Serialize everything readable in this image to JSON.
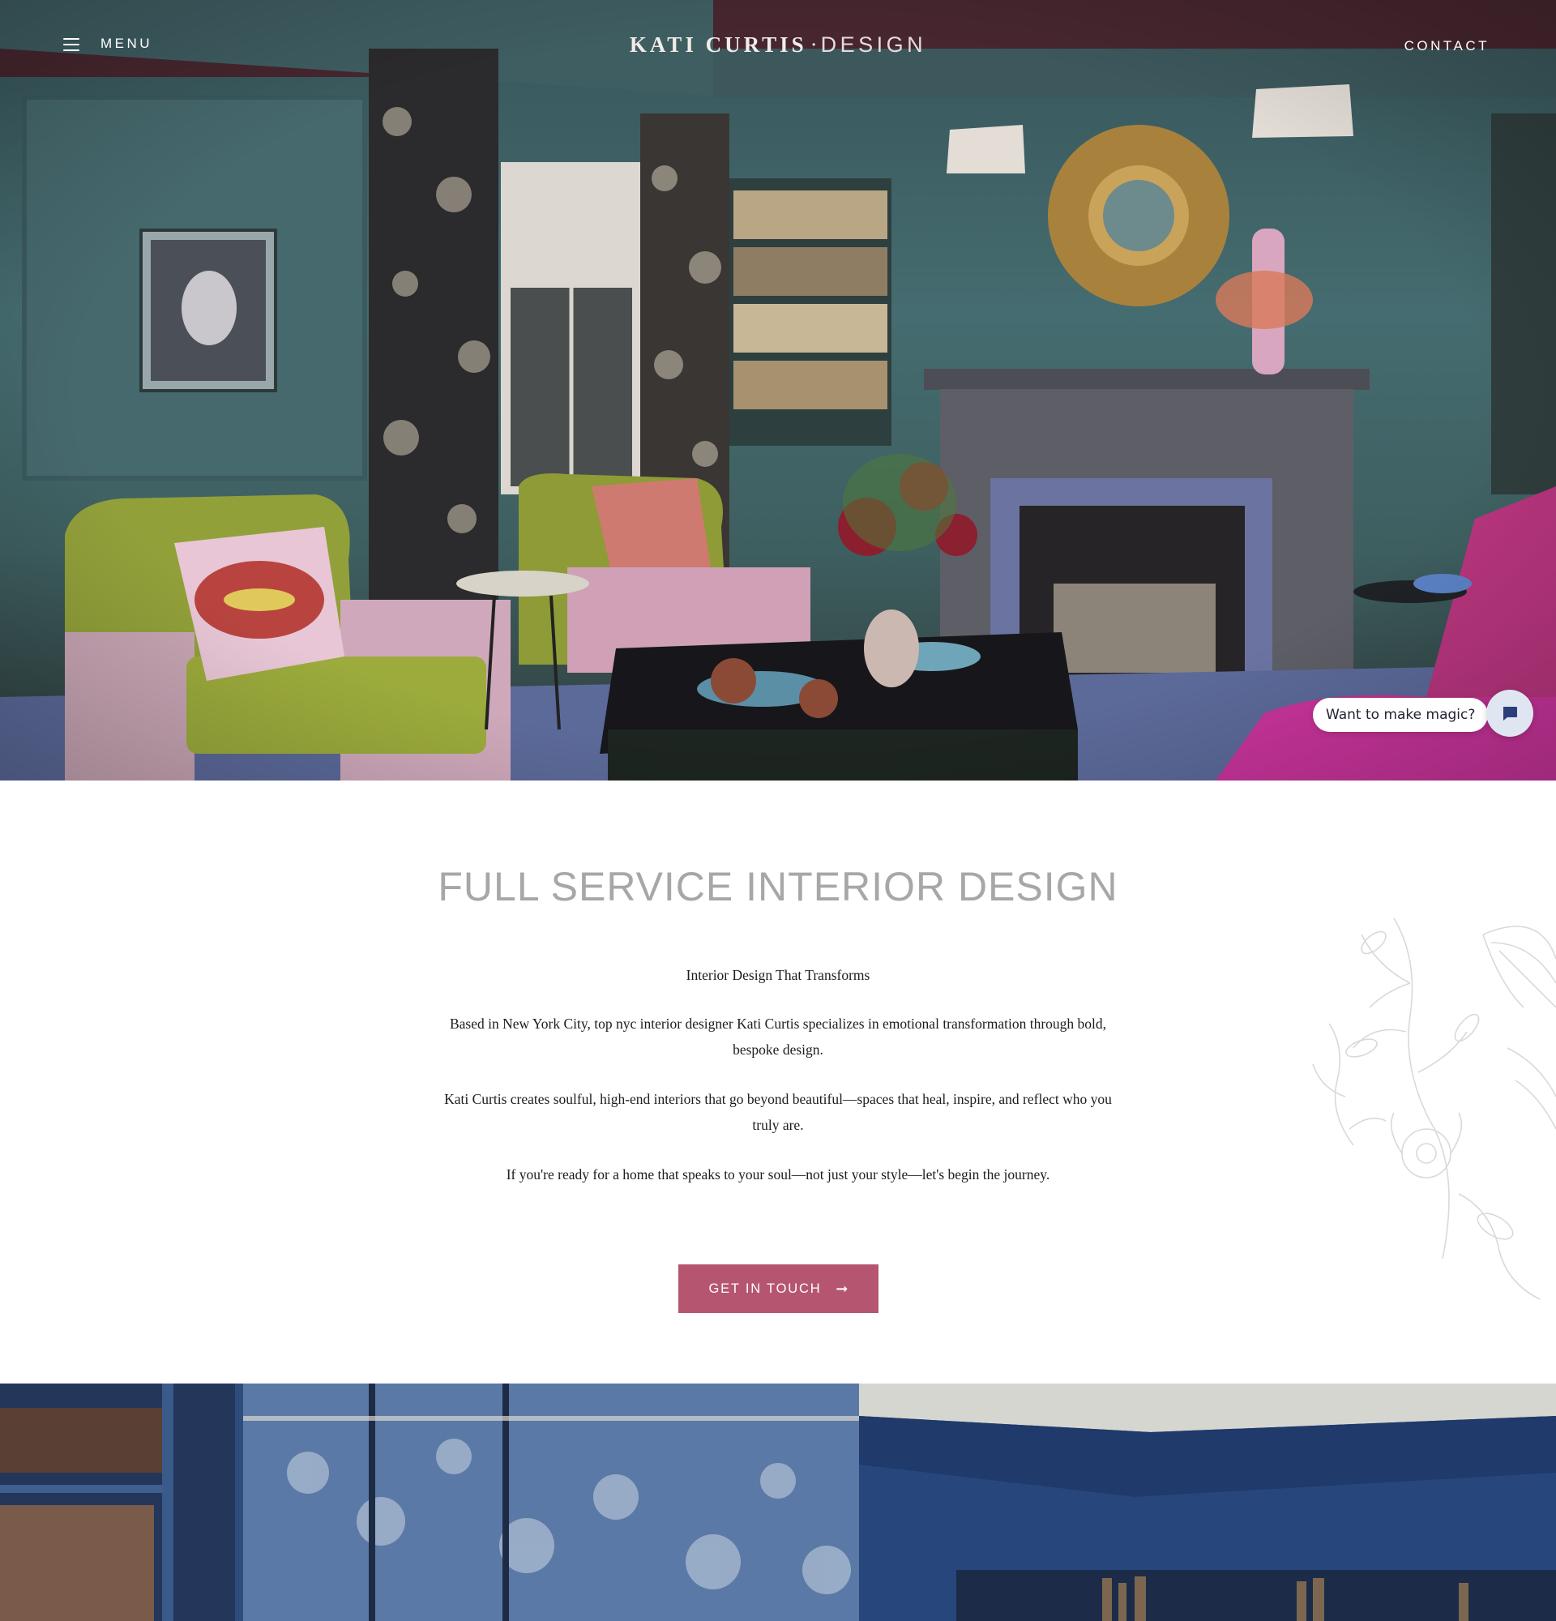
{
  "nav": {
    "menu_label": "MENU",
    "contact_label": "CONTACT",
    "logo": {
      "name": "KATI CURTIS",
      "separator": "·",
      "suffix": "DESIGN"
    }
  },
  "chat": {
    "bubble_text": "Want to make magic?",
    "icon": "chat-icon"
  },
  "intro": {
    "heading": "FULL SERVICE INTERIOR DESIGN",
    "tagline": "Interior Design That Transforms",
    "paragraphs": [
      "Based in New York City, top nyc interior designer Kati Curtis specializes in emotional transformation through bold, bespoke design.",
      "Kati Curtis creates soulful, high-end interiors that go beyond beautiful—spaces that heal, inspire, and reflect who you truly are.",
      "If you're ready for a home that speaks to your soul—not just your style—let's begin the journey."
    ],
    "cta_label": "GET IN TOUCH",
    "cta_icon": "arrow-right-icon"
  },
  "colors": {
    "accent": "#b65570",
    "heading_gray": "#a7a7a7",
    "chat_launcher": "#dfe6f2"
  }
}
